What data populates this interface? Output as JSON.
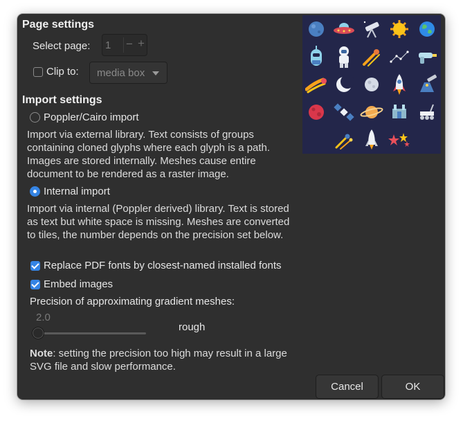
{
  "page_settings": {
    "heading": "Page settings",
    "select_page_label": "Select page:",
    "page_value": "1",
    "minus_glyph": "−",
    "plus_glyph": "+",
    "clip_to_label": "Clip to:",
    "clip_to_checked": false,
    "clip_to_value": "media box"
  },
  "import_settings": {
    "heading": "Import settings",
    "poppler_option": {
      "label": "Poppler/Cairo import",
      "selected": false,
      "description": "Import via external library. Text consists of groups containing cloned glyphs where each glyph is a path. Images are stored internally. Meshes cause entire document to be rendered as a raster image."
    },
    "internal_option": {
      "label": "Internal import",
      "selected": true,
      "description": "Import via internal (Poppler derived) library. Text is stored as text but white space is missing. Meshes are converted to tiles, the number depends on the precision set below."
    },
    "replace_fonts": {
      "label": "Replace PDF fonts by closest-named installed fonts",
      "checked": true
    },
    "embed_images": {
      "label": "Embed images",
      "checked": true
    },
    "precision_label": "Precision of approximating gradient meshes:",
    "precision_value": "2.0",
    "precision_level": "rough",
    "note_bold": "Note",
    "note_text": ": setting the precision too high may result in a large SVG file and slow performance."
  },
  "preview": {
    "icons": [
      "planet-icon",
      "ufo-icon",
      "telescope-icon",
      "sun-icon",
      "earth-icon",
      "alien-icon",
      "astronaut-icon",
      "meteor-icon",
      "constellation-icon",
      "ray-gun-icon",
      "comet-icon",
      "crescent-moon-icon",
      "moon-icon",
      "rocket-icon",
      "observatory-icon",
      "red-planet-icon",
      "satellite-icon",
      "saturn-icon",
      "space-station-icon",
      "rover-icon",
      "shooting-stars-icon",
      "shuttle-icon",
      "stars-icon"
    ]
  },
  "buttons": {
    "cancel": "Cancel",
    "ok": "OK"
  },
  "colors": {
    "background": "#2f2f2f",
    "accent": "#3584e4",
    "preview_bg": "#23264a"
  }
}
